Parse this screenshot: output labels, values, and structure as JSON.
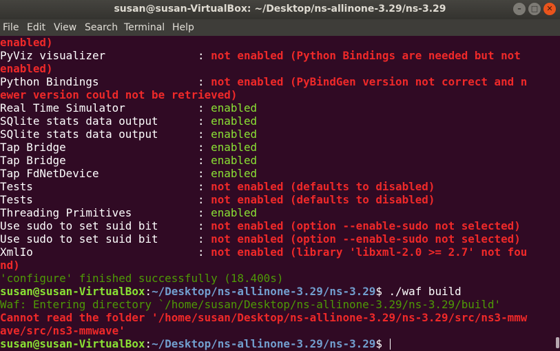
{
  "window": {
    "title": "susan@susan-VirtualBox: ~/Desktop/ns-allinone-3.29/ns-3.29",
    "minimize": "–",
    "maximize": "□",
    "close": "✕"
  },
  "menu": [
    "File",
    "Edit",
    "View",
    "Search",
    "Terminal",
    "Help"
  ],
  "colors": {
    "background": "#300a24",
    "red": "#ef2929",
    "green": "#8ae234",
    "blue": "#729fcf"
  },
  "terminal": {
    "lines": [
      {
        "segments": [
          {
            "text": "enabled)",
            "style": "red"
          }
        ]
      },
      {
        "segments": [
          {
            "text": "PyViz visualizer              : ",
            "style": "plain"
          },
          {
            "text": "not enabled (Python Bindings are needed but not",
            "style": "red"
          }
        ]
      },
      {
        "segments": [
          {
            "text": "enabled)",
            "style": "red"
          }
        ]
      },
      {
        "segments": [
          {
            "text": "Python Bindings               : ",
            "style": "plain"
          },
          {
            "text": "not enabled (PyBindGen version not correct and n",
            "style": "red"
          }
        ]
      },
      {
        "segments": [
          {
            "text": "ewer version could not be retrieved)",
            "style": "red"
          }
        ]
      },
      {
        "segments": [
          {
            "text": "Real Time Simulator           : ",
            "style": "plain"
          },
          {
            "text": "enabled",
            "style": "green"
          }
        ]
      },
      {
        "segments": [
          {
            "text": "SQlite stats data output      : ",
            "style": "plain"
          },
          {
            "text": "enabled",
            "style": "green"
          }
        ]
      },
      {
        "segments": [
          {
            "text": "SQlite stats data output      : ",
            "style": "plain"
          },
          {
            "text": "enabled",
            "style": "green"
          }
        ]
      },
      {
        "segments": [
          {
            "text": "Tap Bridge                    : ",
            "style": "plain"
          },
          {
            "text": "enabled",
            "style": "green"
          }
        ]
      },
      {
        "segments": [
          {
            "text": "Tap Bridge                    : ",
            "style": "plain"
          },
          {
            "text": "enabled",
            "style": "green"
          }
        ]
      },
      {
        "segments": [
          {
            "text": "Tap FdNetDevice               : ",
            "style": "plain"
          },
          {
            "text": "enabled",
            "style": "green"
          }
        ]
      },
      {
        "segments": [
          {
            "text": "Tests                         : ",
            "style": "plain"
          },
          {
            "text": "not enabled (defaults to disabled)",
            "style": "red"
          }
        ]
      },
      {
        "segments": [
          {
            "text": "Tests                         : ",
            "style": "plain"
          },
          {
            "text": "not enabled (defaults to disabled)",
            "style": "red"
          }
        ]
      },
      {
        "segments": [
          {
            "text": "Threading Primitives          : ",
            "style": "plain"
          },
          {
            "text": "enabled",
            "style": "green"
          }
        ]
      },
      {
        "segments": [
          {
            "text": "Use sudo to set suid bit      : ",
            "style": "plain"
          },
          {
            "text": "not enabled (option --enable-sudo not selected)",
            "style": "red"
          }
        ]
      },
      {
        "segments": [
          {
            "text": "Use sudo to set suid bit      : ",
            "style": "plain"
          },
          {
            "text": "not enabled (option --enable-sudo not selected)",
            "style": "red"
          }
        ]
      },
      {
        "segments": [
          {
            "text": "XmlIo                         : ",
            "style": "plain"
          },
          {
            "text": "not enabled (library 'libxml-2.0 >= 2.7' not fou",
            "style": "red"
          }
        ]
      },
      {
        "segments": [
          {
            "text": "nd)",
            "style": "red"
          }
        ]
      },
      {
        "segments": [
          {
            "text": "'configure' finished successfully (18.400s)",
            "style": "dim-green"
          }
        ]
      },
      {
        "segments": [
          {
            "text": "susan@susan-VirtualBox",
            "style": "ugreen"
          },
          {
            "text": ":",
            "style": "plain"
          },
          {
            "text": "~/Desktop/ns-allinone-3.29/ns-3.29",
            "style": "ublue"
          },
          {
            "text": "$ ./waf build",
            "style": "plain"
          }
        ]
      },
      {
        "segments": [
          {
            "text": "Waf: Entering directory `/home/susan/Desktop/ns-allinone-3.29/ns-3.29/build'",
            "style": "dim-green"
          }
        ]
      },
      {
        "segments": [
          {
            "text": "Cannot read the folder '/home/susan/Desktop/ns-allinone-3.29/ns-3.29/src/ns3-mmw",
            "style": "red"
          }
        ]
      },
      {
        "segments": [
          {
            "text": "ave/src/ns3-mmwave'",
            "style": "red"
          }
        ]
      },
      {
        "segments": [
          {
            "text": "susan@susan-VirtualBox",
            "style": "ugreen"
          },
          {
            "text": ":",
            "style": "plain"
          },
          {
            "text": "~/Desktop/ns-allinone-3.29/ns-3.29",
            "style": "ublue"
          },
          {
            "text": "$ ",
            "style": "plain"
          }
        ],
        "cursor": true
      }
    ]
  }
}
